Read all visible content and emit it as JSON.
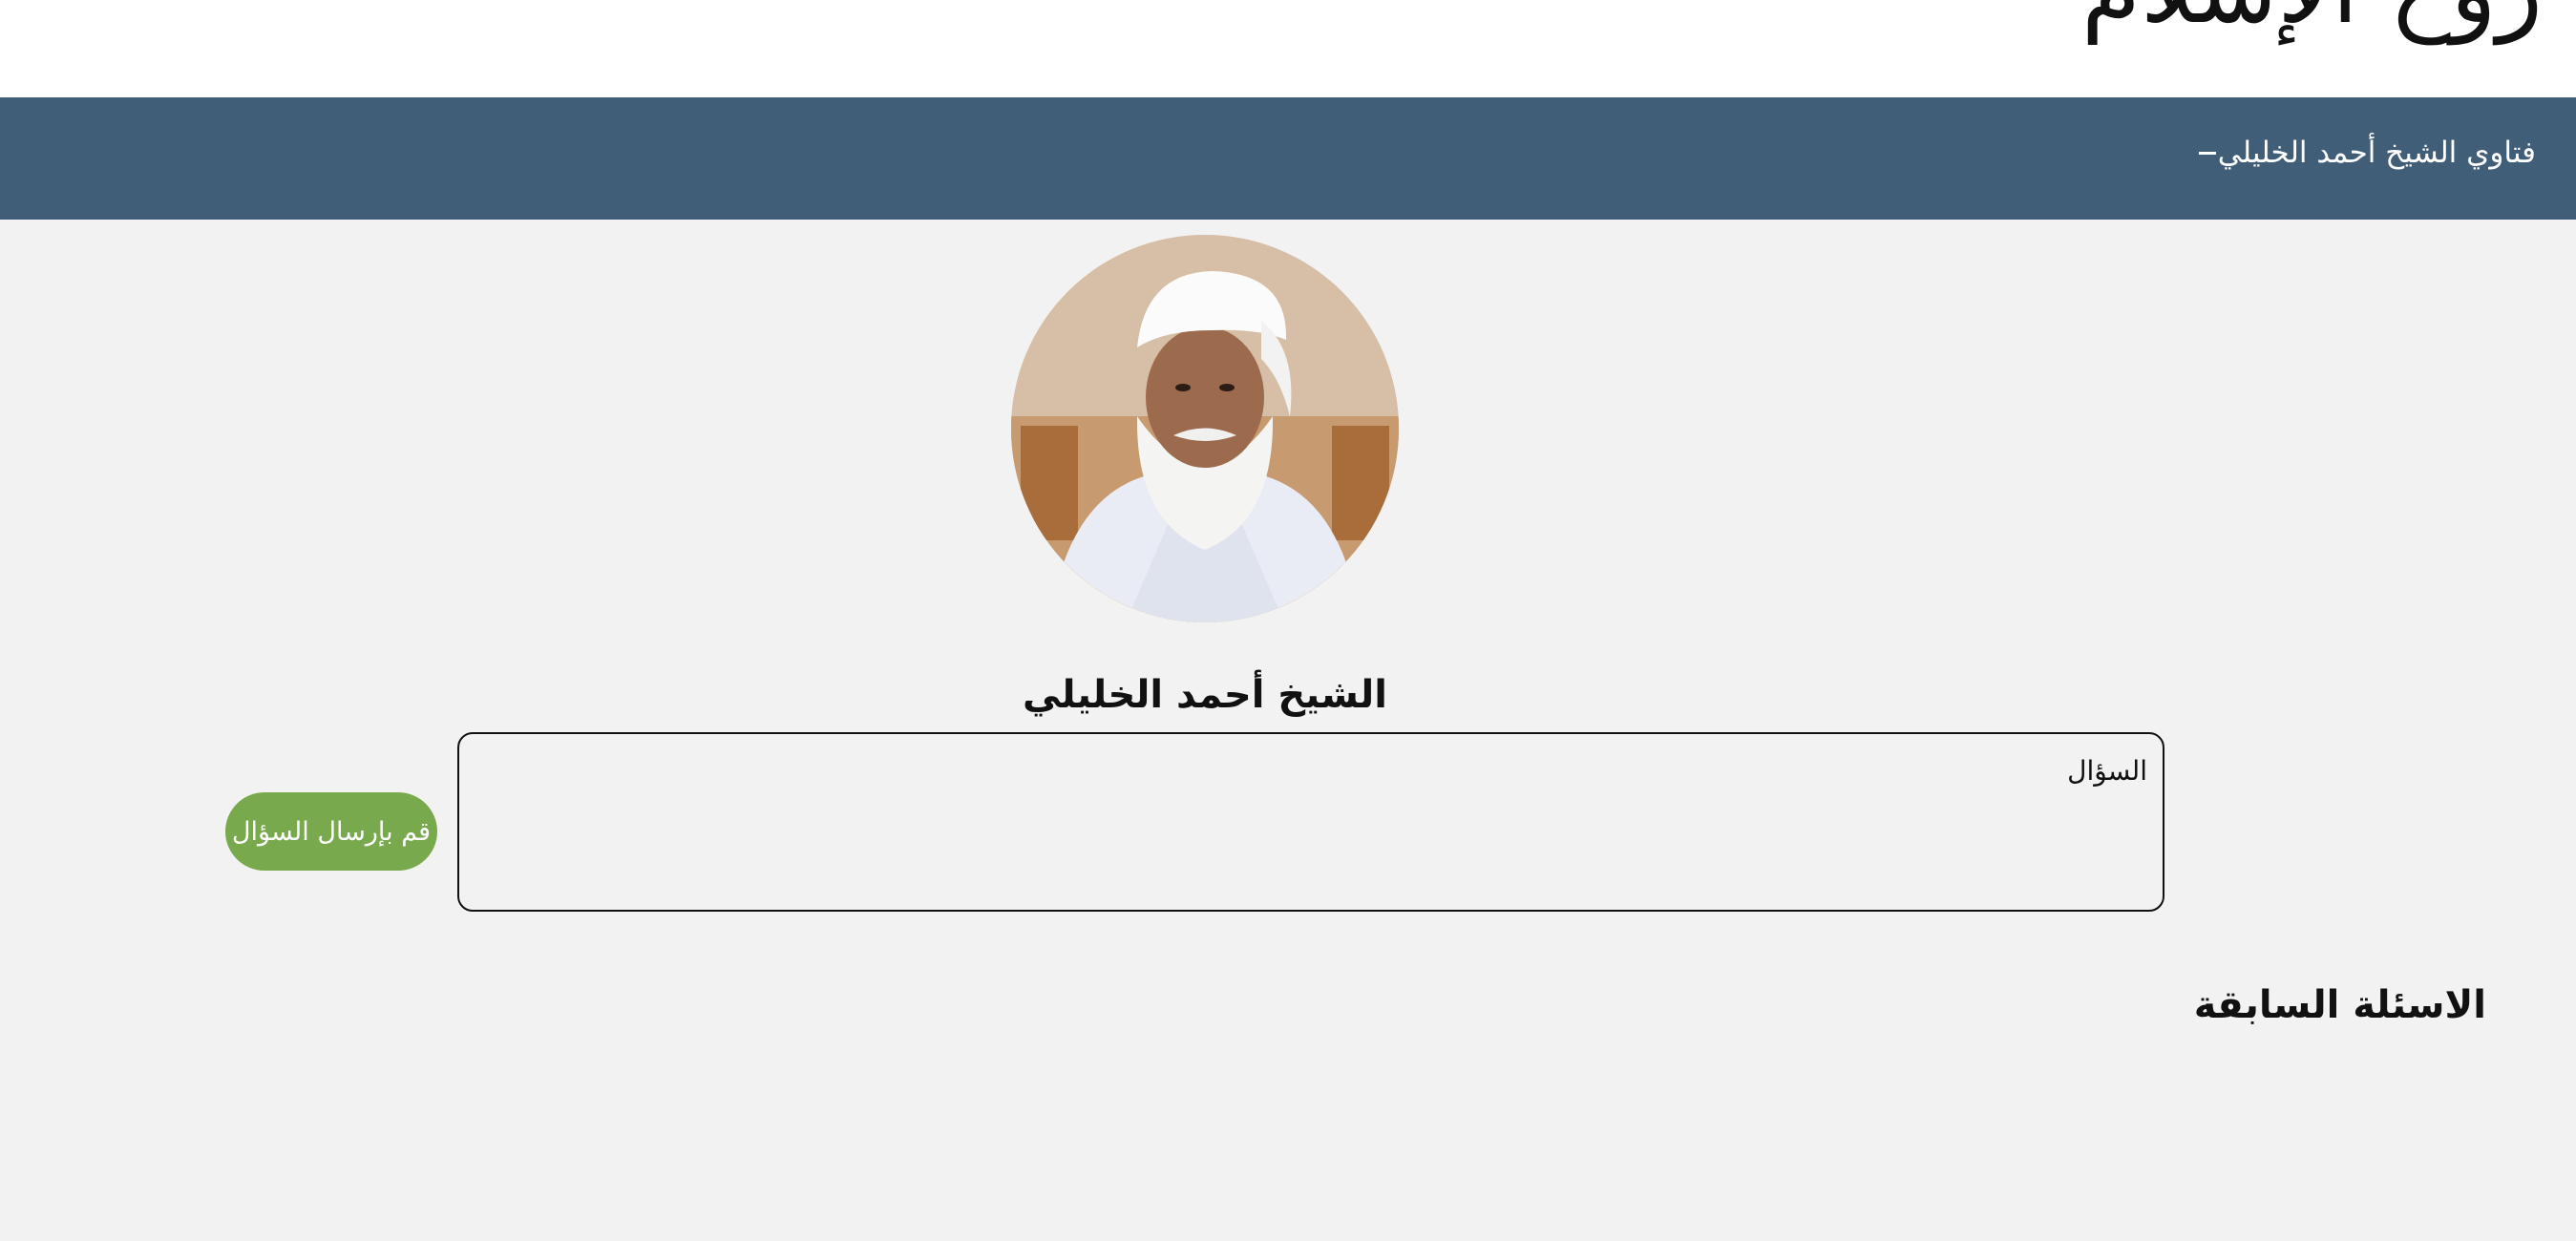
{
  "header": {
    "logo_text": "روح الإسلام"
  },
  "navbar": {
    "title": "فتاوي الشيخ أحمد الخليلي"
  },
  "profile": {
    "name": "الشيخ أحمد الخليلي"
  },
  "question_form": {
    "placeholder": "السؤال",
    "value": "",
    "submit_label": "قم بإرسال السؤال"
  },
  "previous_questions": {
    "heading": "الاسئلة السابقة"
  },
  "colors": {
    "navbar": "#415e79",
    "button": "#78aa4d",
    "background": "#f2f2f2"
  }
}
